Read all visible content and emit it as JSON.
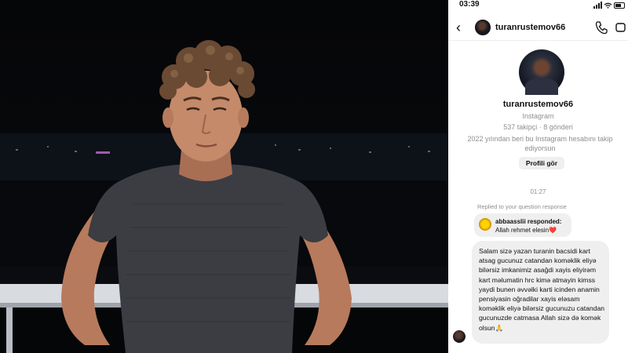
{
  "status_bar": {
    "time": "03:39"
  },
  "header": {
    "username": "turanrustemov66",
    "back_icon": "chevron-left-icon",
    "call_icon": "phone-icon",
    "video_icon": "video-camera-icon"
  },
  "profile": {
    "username": "turanrustemov66",
    "platform": "Instagram",
    "stats": "537 takipçi · 8 gönderi",
    "since": "2022 yılından beri bu Instagram hesabını takip ediyorsun",
    "view_profile_label": "Profili gör"
  },
  "conversation": {
    "timestamp": "01:27",
    "replied_label": "Replied to your question response",
    "reply_card": {
      "user": "abbaasslii responded:",
      "text": "Allah rehmet elesin❤️"
    },
    "message": "Salam sizə yazan turanin bacsidi kart atsag gucunuz catandan koməklik eliyə bilərsiz imkanimiz asağdi xayis eliyirəm kart məlumatin hrc kimə atmayin kimss yaydi bunen əvvəlki karti icinden anamin pensiyasin oğradilar xayis eləsam koməklik eliyə bilərsiz gucunuzu catandan gucunuzde catmasa Allah sizə də komək olsun🙏"
  },
  "colors": {
    "bubble": "#efefef",
    "muted_text": "#8e8e8e",
    "photo_background": "#050608"
  }
}
